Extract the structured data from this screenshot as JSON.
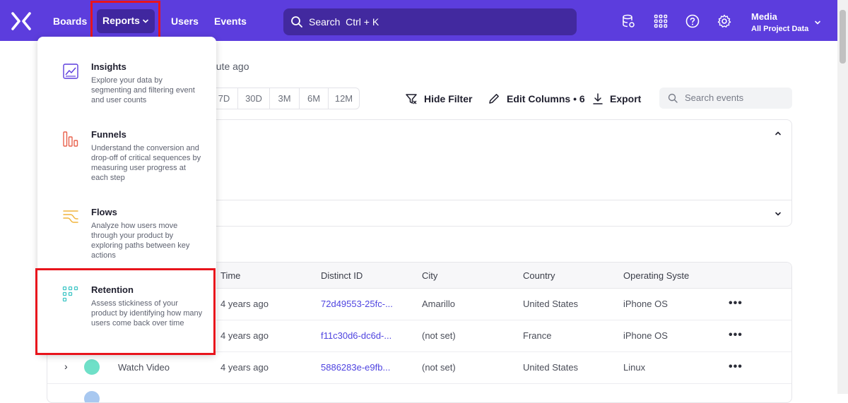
{
  "nav": {
    "items": [
      "Boards",
      "Reports",
      "Users",
      "Events"
    ],
    "search_placeholder": "Search",
    "search_shortcut": "Ctrl + K",
    "project_name": "Media",
    "project_sub": "All Project Data"
  },
  "content": {
    "updated_text": "nute ago",
    "ranges": [
      "7D",
      "30D",
      "3M",
      "6M",
      "12M"
    ],
    "toolbar": {
      "hide_filter": "Hide Filter",
      "edit_columns": "Edit Columns • 6",
      "export": "Export",
      "search_placeholder": "Search events"
    }
  },
  "table": {
    "headers": [
      "Time",
      "Distinct ID",
      "City",
      "Country",
      "Operating Syste"
    ],
    "rows": [
      {
        "event": "",
        "time": "4 years ago",
        "distinct_id": "72d49553-25fc-...",
        "city": "Amarillo",
        "country": "United States",
        "os": "iPhone OS"
      },
      {
        "event": "",
        "time": "4 years ago",
        "distinct_id": "f11c30d6-dc6d-...",
        "city": "(not set)",
        "country": "France",
        "os": "iPhone OS"
      },
      {
        "event": "Watch Video",
        "time": "4 years ago",
        "distinct_id": "5886283e-e9fb...",
        "city": "(not set)",
        "country": "United States",
        "os": "Linux"
      }
    ]
  },
  "menu": {
    "items": [
      {
        "title": "Insights",
        "desc": "Explore your data by segmenting and filtering event and user counts",
        "icon": "insights-icon",
        "color": "#5c3ddd"
      },
      {
        "title": "Funnels",
        "desc": "Understand the conversion and drop-off of critical sequences by measuring user progress at each step",
        "icon": "funnels-icon",
        "color": "#e8604c"
      },
      {
        "title": "Flows",
        "desc": "Analyze how users move through your product by exploring paths between key actions",
        "icon": "flows-icon",
        "color": "#f0b43c"
      },
      {
        "title": "Retention",
        "desc": "Assess stickiness of your product by identifying how many users come back over time",
        "icon": "retention-icon",
        "color": "#3fc6c6"
      }
    ]
  },
  "colors": {
    "brand": "#5c3ddd",
    "highlight": "#e8141c",
    "link": "#4f44e0"
  }
}
